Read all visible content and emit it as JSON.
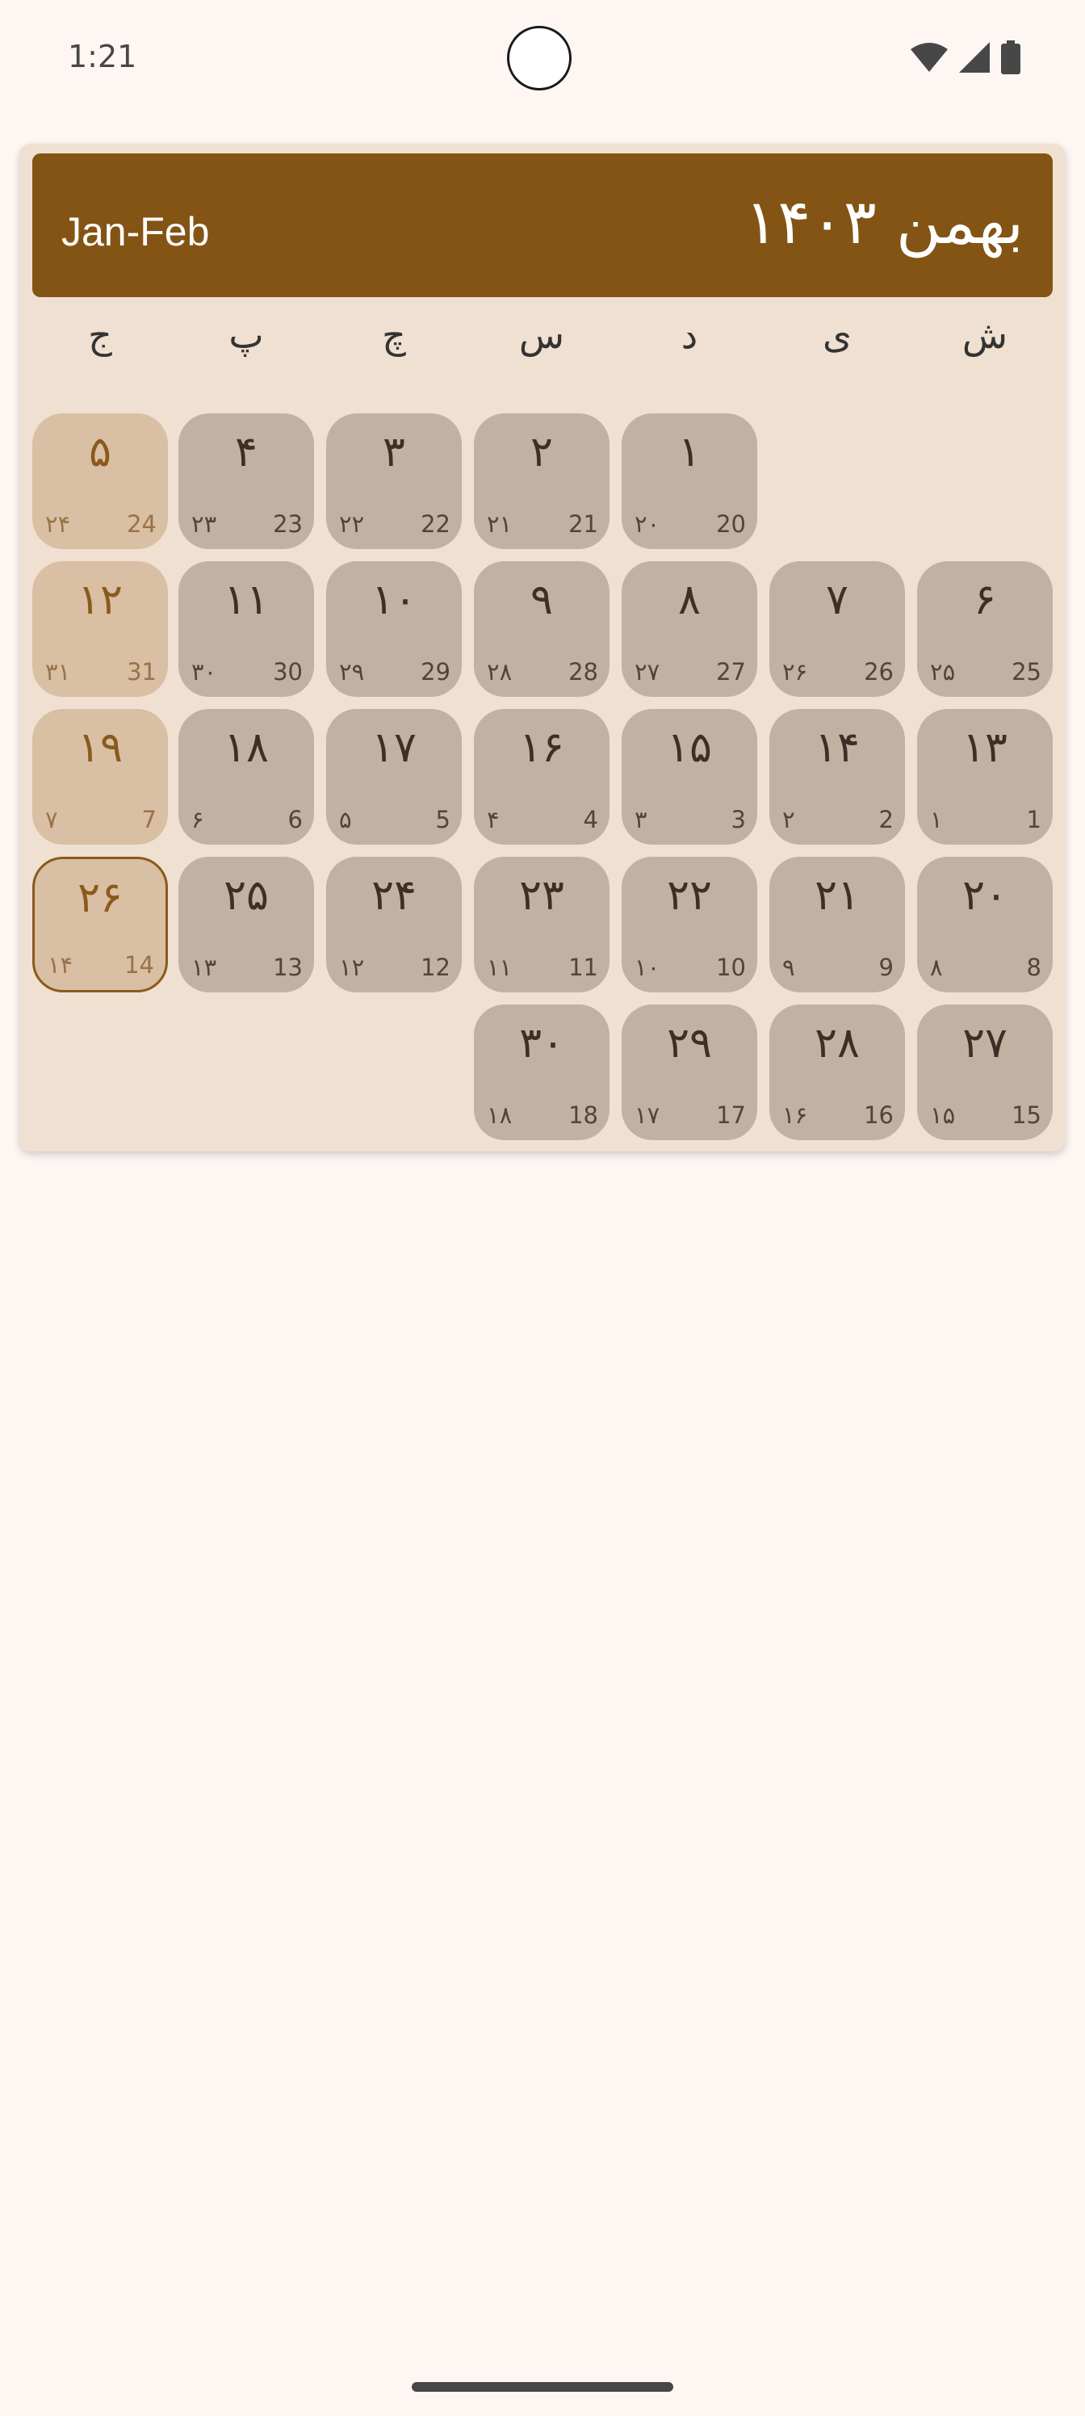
{
  "status_bar": {
    "time": "1:21"
  },
  "header": {
    "month_title": "بهمن ۱۴۰۳",
    "gregorian_range": "Jan-Feb"
  },
  "weekdays": [
    "ش",
    "ی",
    "د",
    "س",
    "چ",
    "پ",
    "ج"
  ],
  "rows": [
    [
      null,
      null,
      {
        "p": "۱",
        "g": "20",
        "h": "۲۰"
      },
      {
        "p": "۲",
        "g": "21",
        "h": "۲۱"
      },
      {
        "p": "۳",
        "g": "22",
        "h": "۲۲"
      },
      {
        "p": "۴",
        "g": "23",
        "h": "۲۳"
      },
      {
        "p": "۵",
        "g": "24",
        "h": "۲۴"
      }
    ],
    [
      {
        "p": "۶",
        "g": "25",
        "h": "۲۵"
      },
      {
        "p": "۷",
        "g": "26",
        "h": "۲۶"
      },
      {
        "p": "۸",
        "g": "27",
        "h": "۲۷"
      },
      {
        "p": "۹",
        "g": "28",
        "h": "۲۸"
      },
      {
        "p": "۱۰",
        "g": "29",
        "h": "۲۹"
      },
      {
        "p": "۱۱",
        "g": "30",
        "h": "۳۰"
      },
      {
        "p": "۱۲",
        "g": "31",
        "h": "۳۱"
      }
    ],
    [
      {
        "p": "۱۳",
        "g": "1",
        "h": "۱"
      },
      {
        "p": "۱۴",
        "g": "2",
        "h": "۲"
      },
      {
        "p": "۱۵",
        "g": "3",
        "h": "۳"
      },
      {
        "p": "۱۶",
        "g": "4",
        "h": "۴"
      },
      {
        "p": "۱۷",
        "g": "5",
        "h": "۵"
      },
      {
        "p": "۱۸",
        "g": "6",
        "h": "۶"
      },
      {
        "p": "۱۹",
        "g": "7",
        "h": "۷"
      }
    ],
    [
      {
        "p": "۲۰",
        "g": "8",
        "h": "۸"
      },
      {
        "p": "۲۱",
        "g": "9",
        "h": "۹"
      },
      {
        "p": "۲۲",
        "g": "10",
        "h": "۱۰"
      },
      {
        "p": "۲۳",
        "g": "11",
        "h": "۱۱"
      },
      {
        "p": "۲۴",
        "g": "12",
        "h": "۱۲"
      },
      {
        "p": "۲۵",
        "g": "13",
        "h": "۱۳"
      },
      {
        "p": "۲۶",
        "g": "14",
        "h": "۱۴",
        "today": true
      }
    ],
    [
      {
        "p": "۲۷",
        "g": "15",
        "h": "۱۵"
      },
      {
        "p": "۲۸",
        "g": "16",
        "h": "۱۶"
      },
      {
        "p": "۲۹",
        "g": "17",
        "h": "۱۷"
      },
      {
        "p": "۳۰",
        "g": "18",
        "h": "۱۸"
      },
      null,
      null,
      null
    ]
  ],
  "colors": {
    "header_bg": "#835414",
    "card_bg": "#efe0d2",
    "day_bg": "#c2b0a2",
    "friday_bg": "#d9bfa3",
    "page_bg": "#fef6f3"
  },
  "icons": [
    "wifi-icon",
    "cellular-signal-icon",
    "battery-icon"
  ]
}
